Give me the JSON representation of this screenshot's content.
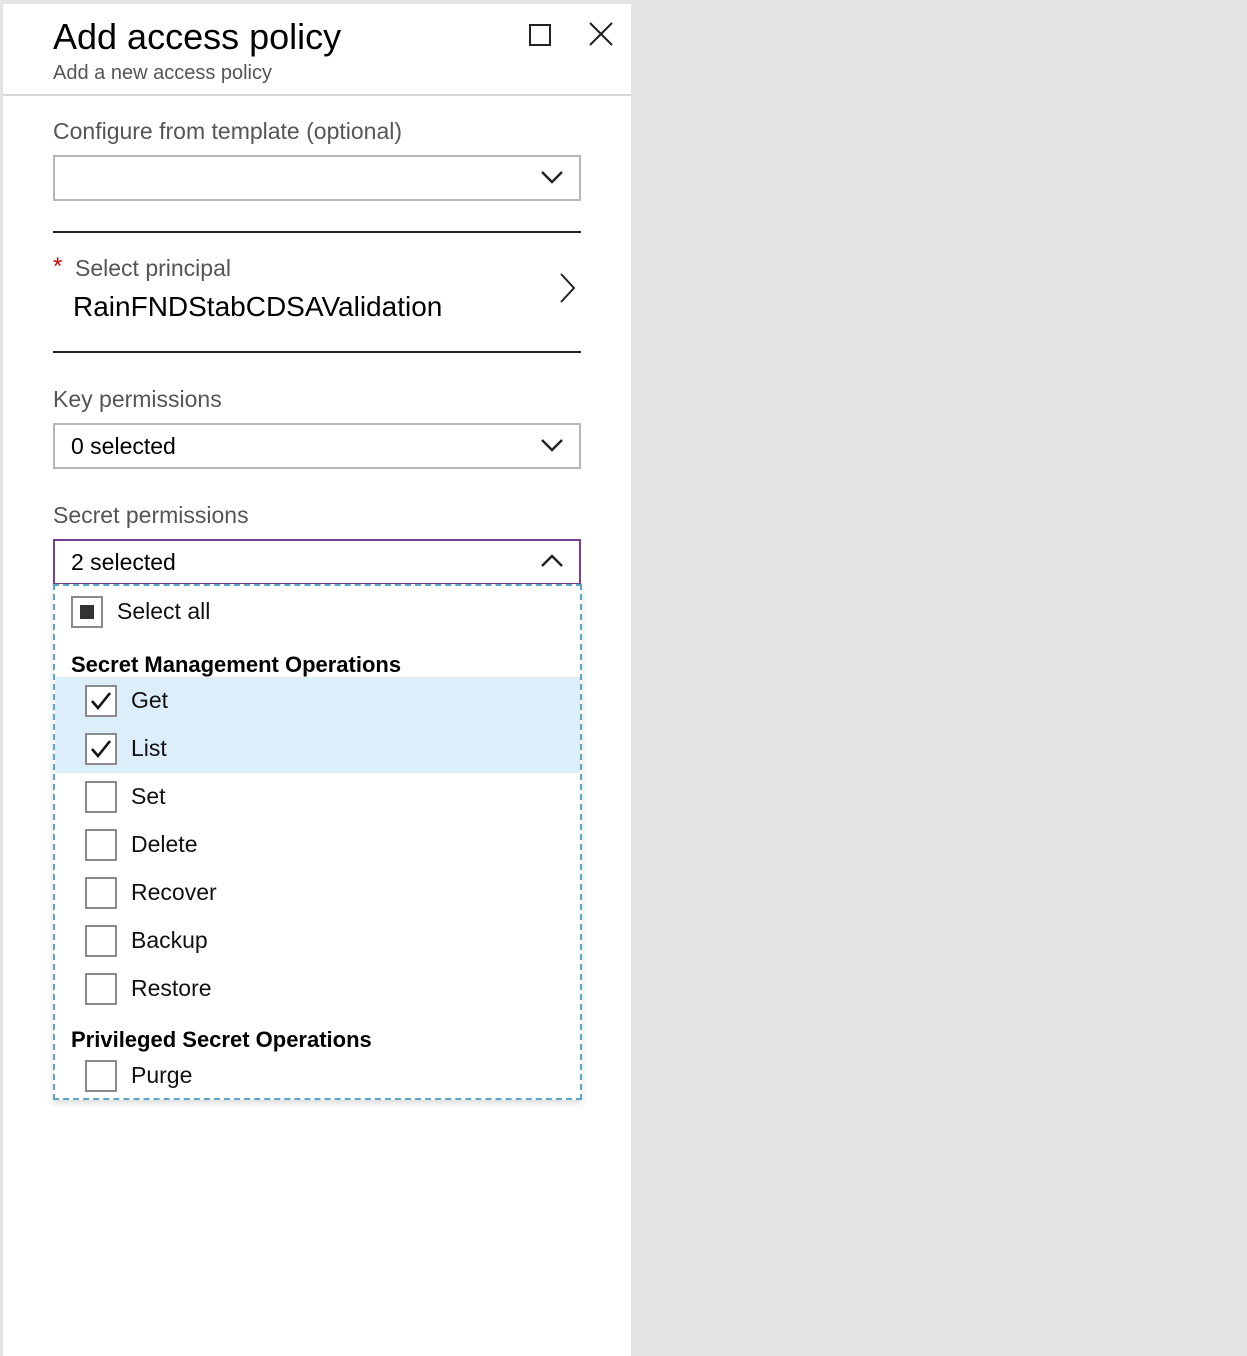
{
  "blade": {
    "title": "Add access policy",
    "subtitle": "Add a new access policy"
  },
  "template": {
    "label": "Configure from template (optional)",
    "value": ""
  },
  "principal": {
    "required_mark": "*",
    "label": "Select principal",
    "value": "RainFNDStabCDSAValidation"
  },
  "key_permissions": {
    "label": "Key permissions",
    "value": "0 selected"
  },
  "secret_permissions": {
    "label": "Secret permissions",
    "value": "2 selected",
    "select_all": "Select all",
    "groups": [
      {
        "heading": "Secret Management Operations",
        "items": [
          {
            "label": "Get",
            "checked": true
          },
          {
            "label": "List",
            "checked": true
          },
          {
            "label": "Set",
            "checked": false
          },
          {
            "label": "Delete",
            "checked": false
          },
          {
            "label": "Recover",
            "checked": false
          },
          {
            "label": "Backup",
            "checked": false
          },
          {
            "label": "Restore",
            "checked": false
          }
        ]
      },
      {
        "heading": "Privileged Secret Operations",
        "items": [
          {
            "label": "Purge",
            "checked": false
          }
        ]
      }
    ]
  },
  "colors": {
    "background": "#e4e4e4",
    "selected_row": "#ddeefb",
    "open_dropdown_border": "#7a3d8f",
    "focus_outline": "#5aa7c7",
    "required": "#d40000"
  }
}
